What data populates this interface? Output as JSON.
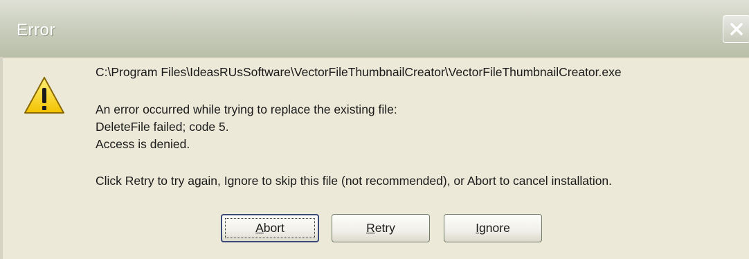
{
  "window": {
    "title": "Error"
  },
  "icons": {
    "close": "close-icon",
    "warning": "warning-triangle-icon"
  },
  "message": {
    "path": "C:\\Program Files\\IdeasRUsSoftware\\VectorFileThumbnailCreator\\VectorFileThumbnailCreator.exe",
    "line1": "An error occurred while trying to replace the existing file:",
    "line2": "DeleteFile failed; code 5.",
    "line3": "Access is denied.",
    "instructions": "Click Retry to try again, Ignore to skip this file (not recommended), or Abort to cancel installation."
  },
  "buttons": {
    "abort": {
      "accel": "A",
      "rest": "bort"
    },
    "retry": {
      "accel": "R",
      "rest": "etry"
    },
    "ignore": {
      "accel": "I",
      "rest": "gnore"
    }
  },
  "colors": {
    "titlebar": "#cfd3c4",
    "dialog_bg": "#ece9d8",
    "warning": "#f7d318"
  }
}
